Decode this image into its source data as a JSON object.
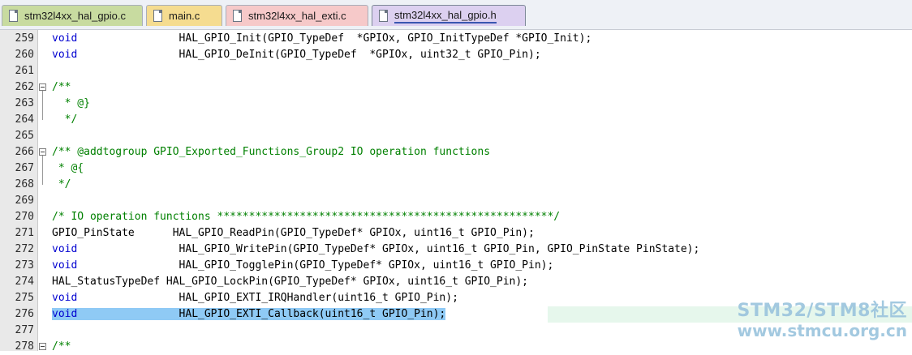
{
  "tabs": [
    {
      "label": "stm32l4xx_hal_gpio.c",
      "color": "#c8dba0",
      "active": false
    },
    {
      "label": "main.c",
      "color": "#f5dc90",
      "active": false
    },
    {
      "label": "stm32l4xx_hal_exti.c",
      "color": "#f6c9c9",
      "active": false
    },
    {
      "label": "stm32l4xx_hal_gpio.h",
      "color": "#dcd0f0",
      "active": true
    }
  ],
  "editor": {
    "lines": [
      {
        "num": "259",
        "segments": [
          {
            "text": "void",
            "cls": "kw"
          },
          {
            "text": "                HAL_GPIO_Init(GPIO_TypeDef  *GPIOx, GPIO_InitTypeDef *GPIO_Init);",
            "cls": ""
          }
        ]
      },
      {
        "num": "260",
        "segments": [
          {
            "text": "void",
            "cls": "kw"
          },
          {
            "text": "                HAL_GPIO_DeInit(GPIO_TypeDef  *GPIOx, uint32_t GPIO_Pin);",
            "cls": ""
          }
        ]
      },
      {
        "num": "261",
        "segments": []
      },
      {
        "num": "262",
        "fold": true,
        "segments": [
          {
            "text": "/**",
            "cls": "cm"
          }
        ]
      },
      {
        "num": "263",
        "segments": [
          {
            "text": "  * @}",
            "cls": "cm"
          }
        ]
      },
      {
        "num": "264",
        "segments": [
          {
            "text": "  */",
            "cls": "cm"
          }
        ]
      },
      {
        "num": "265",
        "segments": []
      },
      {
        "num": "266",
        "fold": true,
        "segments": [
          {
            "text": "/** @addtogroup GPIO_Exported_Functions_Group2 IO operation functions",
            "cls": "cm"
          }
        ]
      },
      {
        "num": "267",
        "segments": [
          {
            "text": " * @{",
            "cls": "cm"
          }
        ]
      },
      {
        "num": "268",
        "segments": [
          {
            "text": " */",
            "cls": "cm"
          }
        ]
      },
      {
        "num": "269",
        "segments": []
      },
      {
        "num": "270",
        "segments": [
          {
            "text": "/* IO operation functions *****************************************************/",
            "cls": "cm"
          }
        ]
      },
      {
        "num": "271",
        "segments": [
          {
            "text": "GPIO_PinState      HAL_GPIO_ReadPin(GPIO_TypeDef* GPIOx, uint16_t GPIO_Pin);",
            "cls": ""
          }
        ]
      },
      {
        "num": "272",
        "segments": [
          {
            "text": "void",
            "cls": "kw"
          },
          {
            "text": "                HAL_GPIO_WritePin(GPIO_TypeDef* GPIOx, uint16_t GPIO_Pin, GPIO_PinState PinState);",
            "cls": ""
          }
        ]
      },
      {
        "num": "273",
        "segments": [
          {
            "text": "void",
            "cls": "kw"
          },
          {
            "text": "                HAL_GPIO_TogglePin(GPIO_TypeDef* GPIOx, uint16_t GPIO_Pin);",
            "cls": ""
          }
        ]
      },
      {
        "num": "274",
        "segments": [
          {
            "text": "HAL_StatusTypeDef HAL_GPIO_LockPin(GPIO_TypeDef* GPIOx, uint16_t GPIO_Pin);",
            "cls": ""
          }
        ]
      },
      {
        "num": "275",
        "segments": [
          {
            "text": "void",
            "cls": "kw"
          },
          {
            "text": "                HAL_GPIO_EXTI_IRQHandler(uint16_t GPIO_Pin);",
            "cls": ""
          }
        ]
      },
      {
        "num": "276",
        "current": true,
        "segments": [
          {
            "text": "void",
            "cls": "kw sel"
          },
          {
            "text": "                HAL_GPIO_EXTI_Callback(uint16_t GPIO_Pin);",
            "cls": "sel"
          }
        ]
      },
      {
        "num": "277",
        "segments": []
      },
      {
        "num": "278",
        "fold": true,
        "segments": [
          {
            "text": "/**",
            "cls": "cm"
          }
        ]
      }
    ]
  },
  "watermark": {
    "line1": "STM32/STM8社区",
    "line2": "www.stmcu.org.cn"
  }
}
